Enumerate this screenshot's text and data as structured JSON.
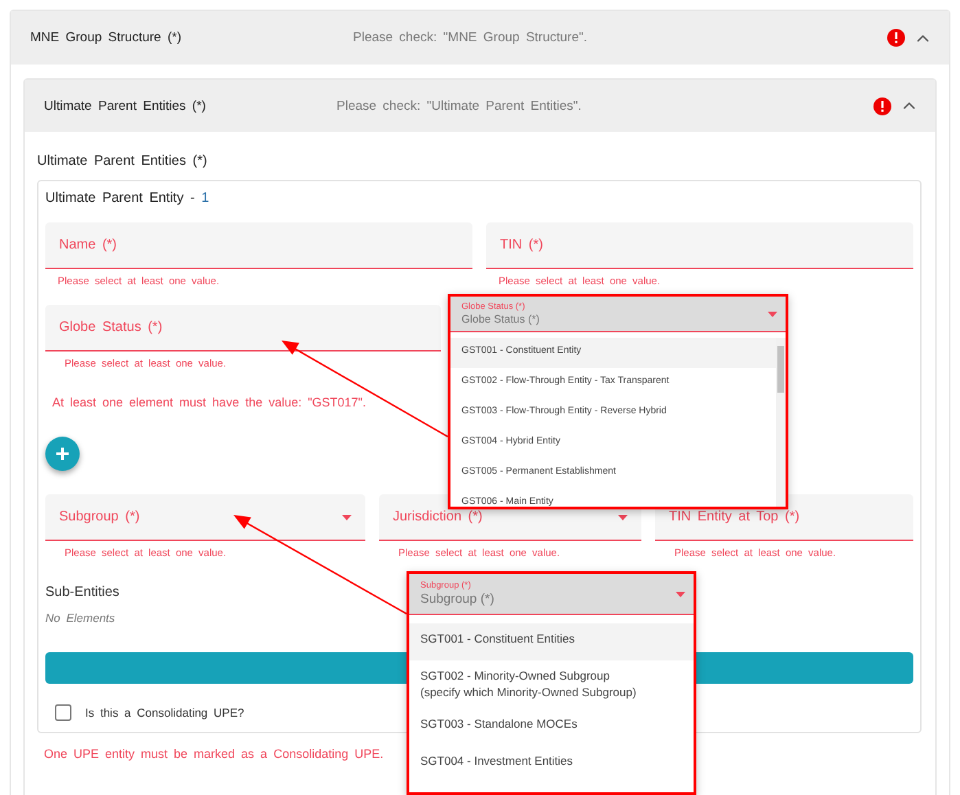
{
  "panel": {
    "title": "MNE Group Structure (*)",
    "message": "Please check: \"MNE Group Structure\".",
    "error": true,
    "expanded": true
  },
  "subpanel": {
    "title": "Ultimate Parent Entities (*)",
    "message": "Please check: \"Ultimate Parent Entities\".",
    "error": true,
    "expanded": true
  },
  "section_title": "Ultimate Parent Entities (*)",
  "card": {
    "title": "Ultimate Parent Entity -",
    "index": "1"
  },
  "field_rows": [
    {
      "fields": [
        {
          "label": "Name (*)",
          "kind": "text",
          "error": "Please select at least one value."
        },
        {
          "label": "TIN (*)",
          "kind": "text",
          "error": "Please select at least one value."
        }
      ]
    },
    {
      "fields": [
        {
          "label": "Globe Status (*)",
          "kind": "text",
          "error": "Please select at least one value."
        }
      ],
      "message": "At least one element must have the value: \"GST017\".",
      "add": true
    },
    {
      "fields": [
        {
          "label": "Subgroup (*)",
          "kind": "select",
          "error": "Please select at least one value."
        },
        {
          "label": "Jurisdiction (*)",
          "kind": "select",
          "error": "Please select at least one value."
        },
        {
          "label": "TIN Entity at Top (*)",
          "kind": "text",
          "error": "Please select at least one value."
        }
      ]
    }
  ],
  "sub_entities": {
    "title": "Sub-Entities",
    "empty_text": "No Elements"
  },
  "consolidating": {
    "label": "Is this a Consolidating UPE?",
    "checked": false
  },
  "footer_error": "One UPE entity must be marked as a Consolidating UPE.",
  "dropdowns": [
    {
      "floating_label": "Globe Status (*)",
      "value": "Globe Status (*)",
      "scrollbar": true,
      "options": [
        {
          "label": "GST001 - Constituent Entity",
          "selected": true
        },
        {
          "label": "GST002 - Flow-Through Entity - Tax Transparent",
          "selected": false
        },
        {
          "label": "GST003 - Flow-Through Entity - Reverse Hybrid",
          "selected": false
        },
        {
          "label": "GST004 - Hybrid Entity",
          "selected": false
        },
        {
          "label": "GST005 - Permanent Establishment",
          "selected": false
        },
        {
          "label": "GST006 - Main Entity",
          "selected": false
        }
      ]
    },
    {
      "floating_label": "Subgroup (*)",
      "value": "Subgroup (*)",
      "scrollbar": false,
      "options": [
        {
          "label": "SGT001 - Constituent Entities",
          "selected": true
        },
        {
          "label": "SGT002 - Minority-Owned Subgroup (specify which Minority-Owned Subgroup)",
          "selected": false
        },
        {
          "label": "SGT003 - Standalone MOCEs",
          "selected": false
        },
        {
          "label": "SGT004 - Investment Entities",
          "selected": false
        }
      ]
    }
  ]
}
